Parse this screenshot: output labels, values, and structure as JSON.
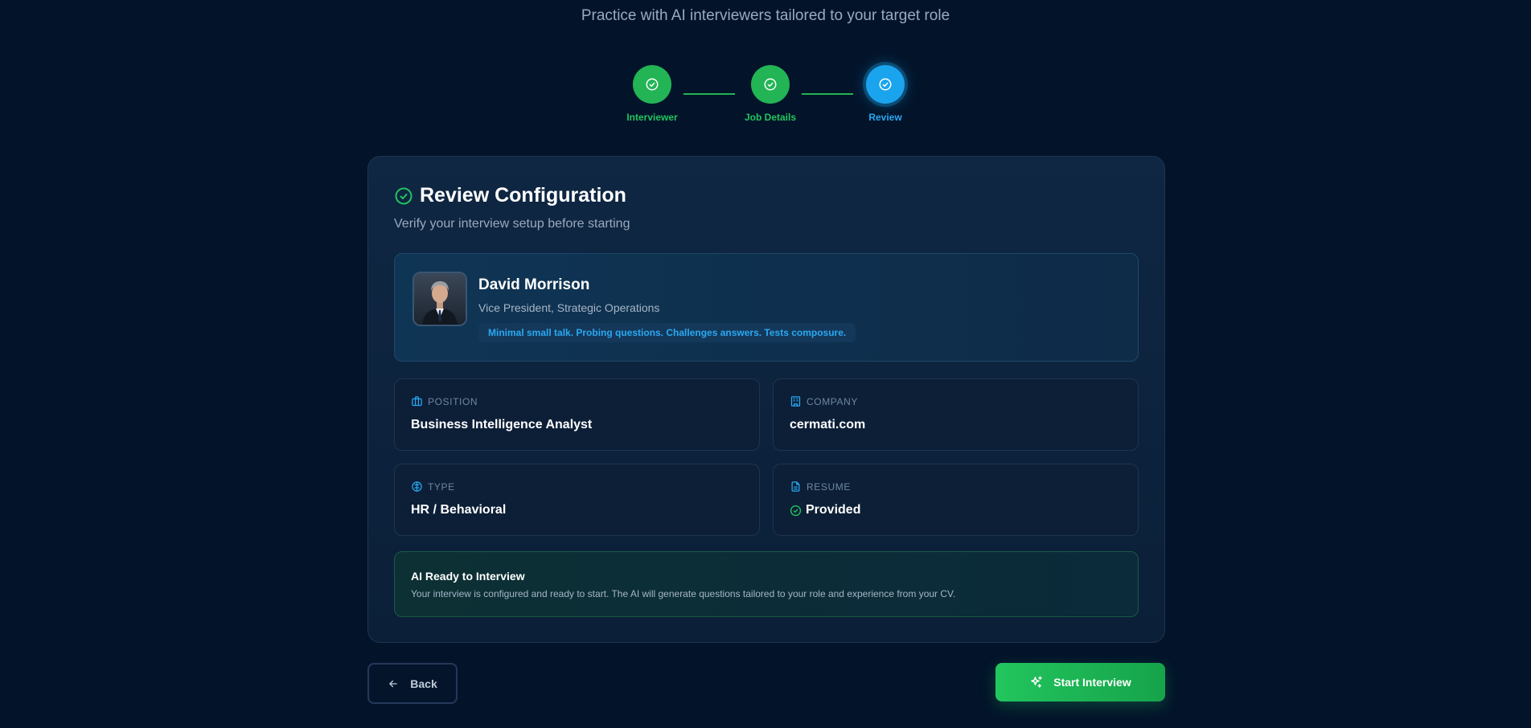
{
  "header": {
    "subtitle": "Practice with AI interviewers tailored to your target role"
  },
  "stepper": {
    "steps": [
      {
        "label": "Interviewer",
        "state": "complete"
      },
      {
        "label": "Job Details",
        "state": "complete"
      },
      {
        "label": "Review",
        "state": "active"
      }
    ]
  },
  "review": {
    "title": "Review Configuration",
    "description": "Verify your interview setup before starting",
    "interviewer": {
      "name": "David Morrison",
      "role": "Vice President, Strategic Operations",
      "style": "Minimal small talk. Probing questions. Challenges answers. Tests composure."
    },
    "fields": {
      "position": {
        "label": "POSITION",
        "value": "Business Intelligence Analyst",
        "icon": "briefcase-icon"
      },
      "company": {
        "label": "COMPANY",
        "value": "cermati.com",
        "icon": "building-icon"
      },
      "type": {
        "label": "TYPE",
        "value": "HR / Behavioral",
        "icon": "brain-icon"
      },
      "resume": {
        "label": "RESUME",
        "value": "Provided",
        "icon": "document-icon"
      }
    },
    "ready": {
      "title": "AI Ready to Interview",
      "description": "Your interview is configured and ready to start. The AI will generate questions tailored to your role and experience from your CV."
    }
  },
  "actions": {
    "back_label": "Back",
    "start_label": "Start Interview"
  },
  "colors": {
    "background": "#03142a",
    "success": "#22c55e",
    "accent": "#1ba4ee"
  }
}
